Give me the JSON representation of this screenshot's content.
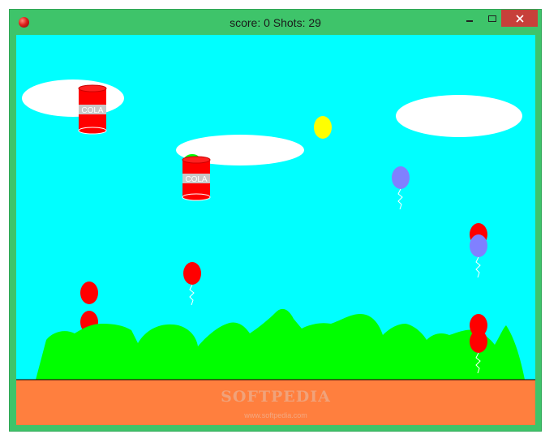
{
  "window": {
    "title": "score: 0 Shots: 29",
    "controls": {
      "minimize": "minimize",
      "maximize": "maximize",
      "close": "close"
    }
  },
  "game": {
    "score": 0,
    "shots": 29,
    "cans": [
      {
        "label": "COLA"
      },
      {
        "label": "COLA"
      }
    ],
    "balloon_colors": [
      "red",
      "yellow",
      "blue-violet"
    ]
  },
  "watermark": {
    "brand": "SOFTPEDIA",
    "url": "www.softpedia.com"
  },
  "colors": {
    "sky": "#00ffff",
    "ground": "#ff7f3e",
    "hills": "#00ff00",
    "cloud": "#ffffff",
    "balloon_red": "#ff0000",
    "balloon_yellow": "#ffff00",
    "balloon_blue": "#8080ff",
    "window_frame": "#3ec46a"
  }
}
